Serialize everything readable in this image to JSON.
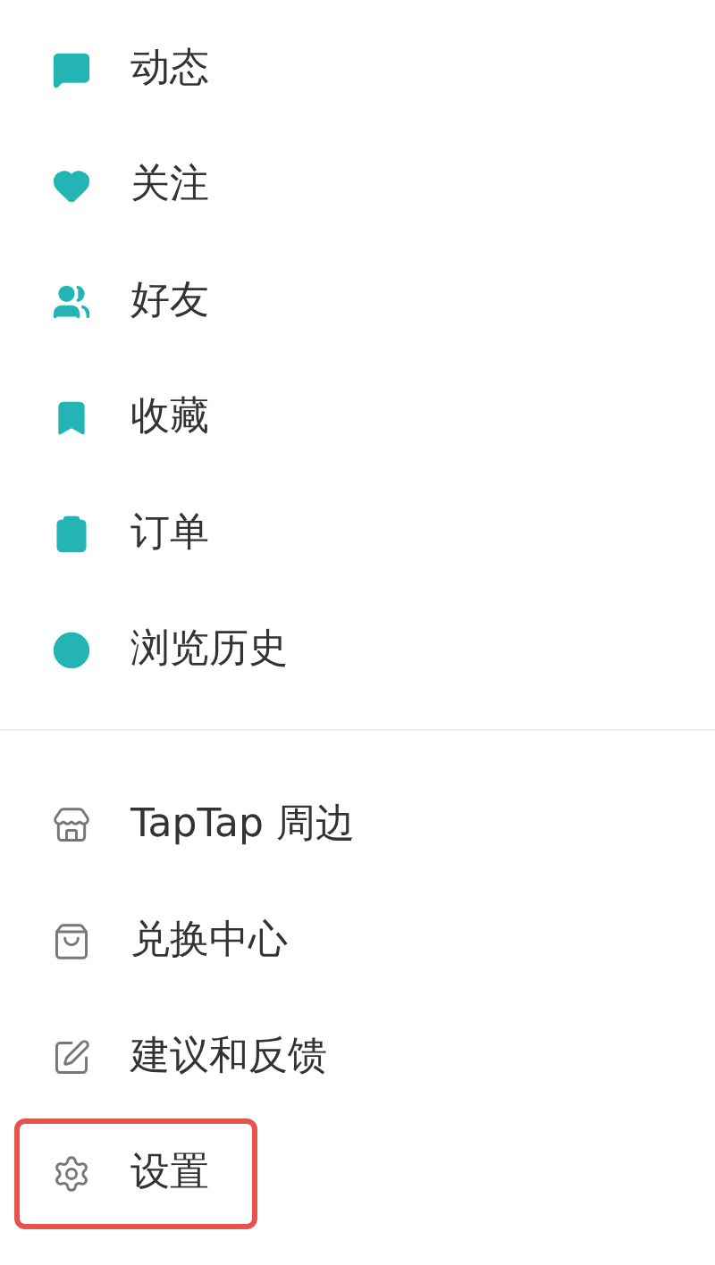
{
  "sections": [
    {
      "kind": "accent",
      "items": [
        {
          "label": "动态",
          "highlighted": false
        },
        {
          "label": "关注",
          "highlighted": false
        },
        {
          "label": "好友",
          "highlighted": false
        },
        {
          "label": "收藏",
          "highlighted": false
        },
        {
          "label": "订单",
          "highlighted": false
        },
        {
          "label": "浏览历史",
          "highlighted": false
        }
      ]
    },
    {
      "kind": "plain",
      "items": [
        {
          "label": "TapTap 周边",
          "highlighted": false
        },
        {
          "label": "兑换中心",
          "highlighted": false
        },
        {
          "label": "建议和反馈",
          "highlighted": false
        },
        {
          "label": "设置",
          "highlighted": true
        }
      ]
    }
  ]
}
